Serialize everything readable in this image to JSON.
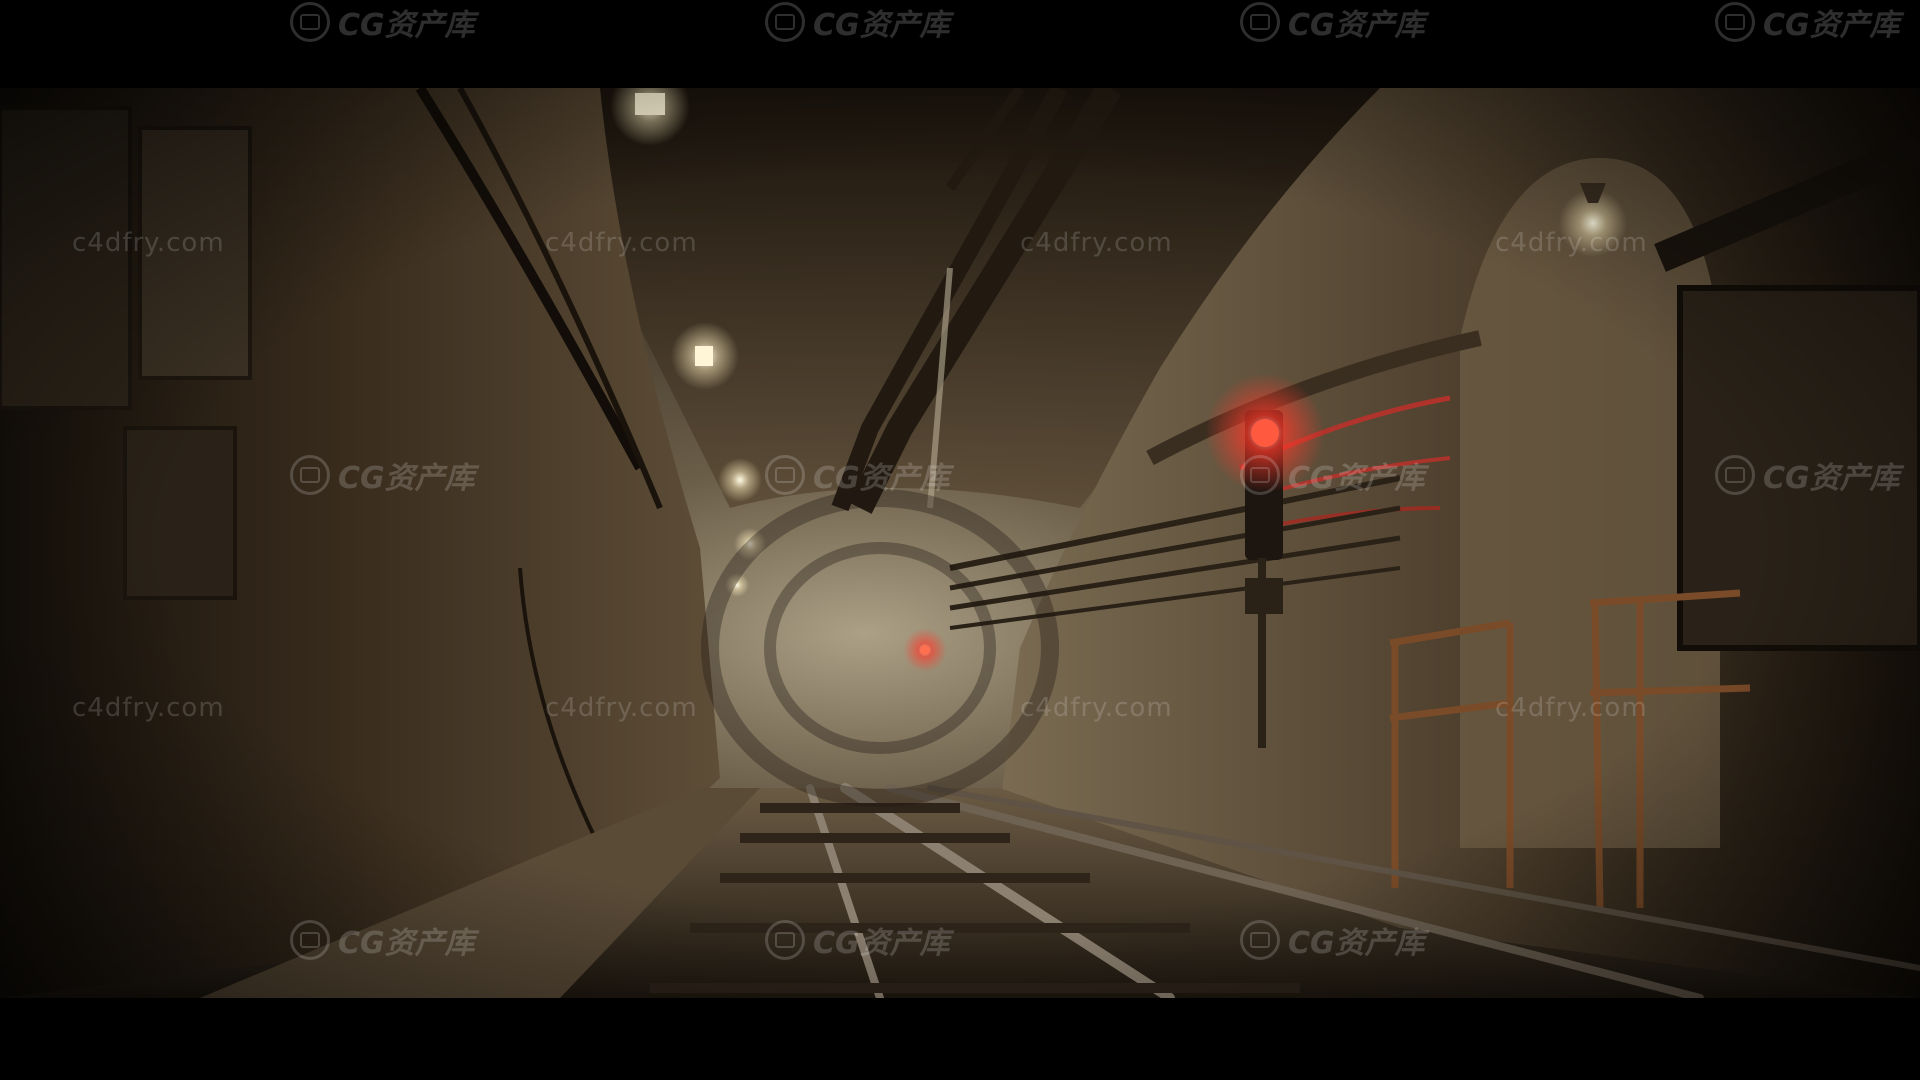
{
  "watermarks": {
    "brand_text": "CG资产库",
    "site_text": "c4dfry.com"
  },
  "scene": {
    "colors": {
      "tunnel_dark": "#1a140d",
      "tunnel_mid": "#4a3b2a",
      "tunnel_light": "#8a7a62",
      "haze": "#a89a80",
      "signal_red": "#ff3a2a",
      "pipe_red": "#c0302a",
      "lamp": "#fff6d8"
    }
  }
}
